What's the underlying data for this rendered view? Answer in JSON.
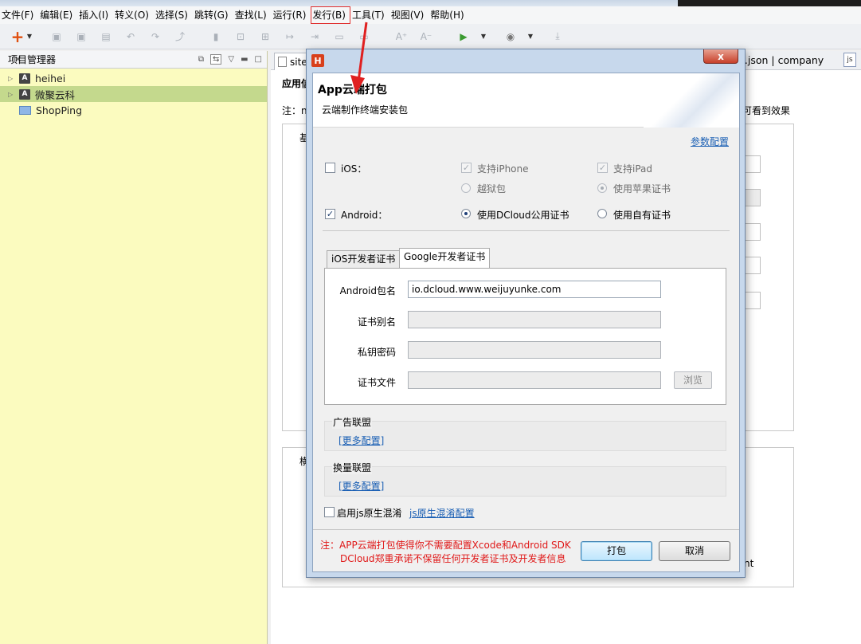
{
  "window": {
    "title_fragment": ""
  },
  "menubar": {
    "items": [
      "文件(F)",
      "编辑(E)",
      "插入(I)",
      "转义(O)",
      "选择(S)",
      "跳转(G)",
      "查找(L)",
      "运行(R)",
      "发行(B)",
      "工具(T)",
      "视图(V)",
      "帮助(H)"
    ],
    "highlighted": "发行(B)"
  },
  "left_panel": {
    "title": "项目管理器",
    "tree": [
      {
        "label": "heihei",
        "type": "app"
      },
      {
        "label": "微聚云科",
        "type": "app",
        "selected": true
      },
      {
        "label": "ShopPing",
        "type": "folder"
      }
    ]
  },
  "editor": {
    "tab_left": "site",
    "tab_right": "t.json | company",
    "tab_right_icon": "js",
    "section_label": "应用信",
    "note_start": "注：n",
    "note_end": "可看到效果",
    "box1_label": "基",
    "box2_label": "横",
    "bottom_fragment": "nt"
  },
  "dialog": {
    "title": "App云端打包",
    "subtitle": "云端制作终端安装包",
    "param_link": "参数配置",
    "ios": {
      "label": "iOS：",
      "checked": false,
      "support_iphone": "支持iPhone",
      "support_ipad": "支持iPad",
      "jailbreak": "越狱包",
      "apple_cert": "使用苹果证书"
    },
    "android": {
      "label": "Android：",
      "checked": true,
      "dcloud_cert": "使用DCloud公用证书",
      "own_cert": "使用自有证书"
    },
    "tabs": [
      "iOS开发者证书",
      "Google开发者证书"
    ],
    "active_tab": "Google开发者证书",
    "form": {
      "package_label": "Android包名",
      "package_value": "io.dcloud.www.weijuyunke.com",
      "alias_label": "证书别名",
      "alias_value": "",
      "password_label": "私钥密码",
      "password_value": "",
      "file_label": "证书文件",
      "file_value": "",
      "browse": "浏览"
    },
    "ad_group": {
      "title": "广告联盟",
      "link": "[更多配置]"
    },
    "exchange_group": {
      "title": "换量联盟",
      "link": "[更多配置]"
    },
    "obfuscate": {
      "label": "启用js原生混淆",
      "link": "js原生混淆配置",
      "checked": false
    },
    "note_line1": "注：APP云端打包使得你不需要配置Xcode和Android SDK",
    "note_line2": "DCloud郑重承诺不保留任何开发者证书及开发者信息",
    "pack_button": "打包",
    "cancel_button": "取消",
    "close_glyph": "x"
  }
}
